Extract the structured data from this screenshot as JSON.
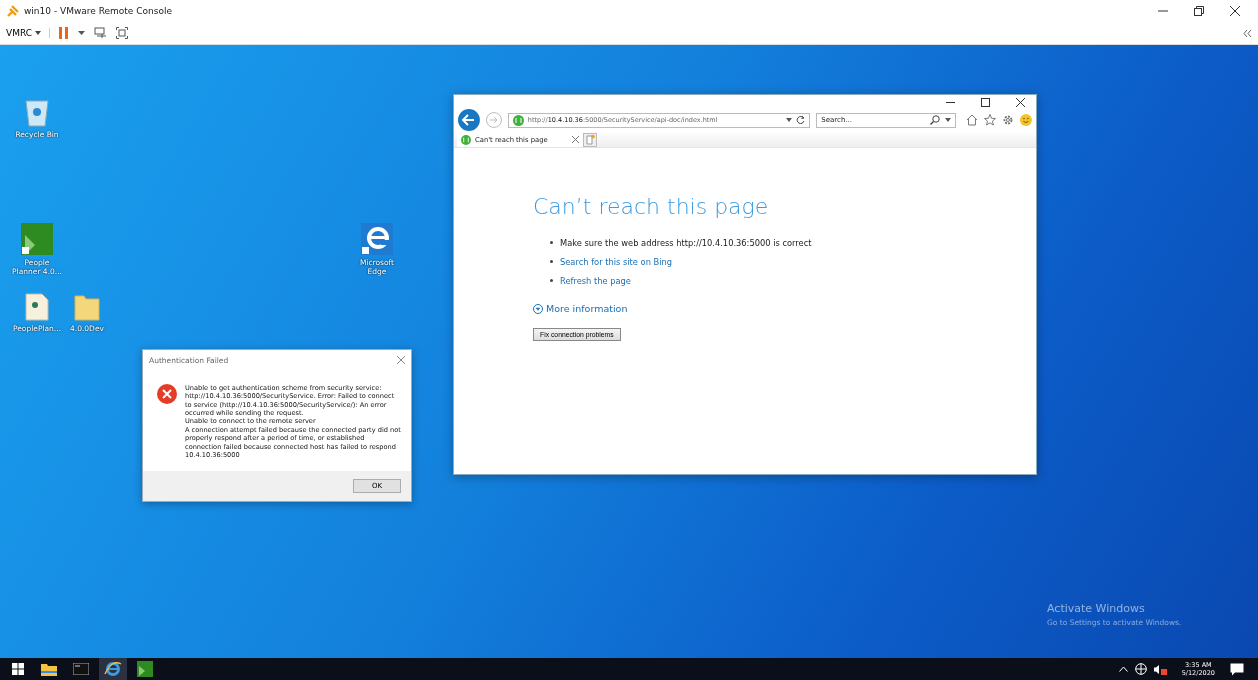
{
  "window": {
    "title": "win10 - VMware Remote Console"
  },
  "toolbar": {
    "menu": "VMRC"
  },
  "desktop_icons": [
    {
      "label": "Recycle Bin",
      "kind": "bin"
    },
    {
      "label": "People Planner 4.0...",
      "kind": "app"
    },
    {
      "label": "PeoplePlan...",
      "kind": "file"
    },
    {
      "label": "4.0.0Dev",
      "kind": "folder"
    },
    {
      "label": "Microsoft Edge",
      "kind": "edge"
    }
  ],
  "dialog": {
    "title": "Authentication Failed",
    "paragraphs": [
      "Unable to get authentication scheme from security service: http://10.4.10.36:5000/SecurityService. Error: Failed to connect to service (http://10.4.10.36:5000/SecurityService/): An error occurred while sending the request.",
      "Unable to connect to the remote server",
      "A connection attempt failed because the connected party did not properly respond after a period of time, or established connection failed because connected host has failed to respond 10.4.10.36:5000"
    ],
    "button": "OK"
  },
  "browser": {
    "address": "http://**10.4.10.36**:5000/SecurityService/api-doc/index.html",
    "search": {
      "placeholder": "Search..."
    },
    "tabs": [
      {
        "label": "Can't reach this page",
        "selected": true
      }
    ],
    "heading": "Can’t reach this page",
    "bullets": [
      {
        "text": "Make sure the web address http://10.4.10.36:5000 is correct",
        "kind": "text"
      },
      {
        "text": "Search for this site on Bing",
        "kind": "link"
      },
      {
        "text": "Refresh the page",
        "kind": "link"
      }
    ],
    "more": "More information",
    "button": "Fix connection problems"
  },
  "activation": {
    "title": "Activate Windows",
    "subtitle": "Go to Settings to activate Windows."
  },
  "taskbar": {
    "apps": [
      {
        "kind": "explorer",
        "selected": false
      },
      {
        "kind": "console",
        "selected": false
      },
      {
        "kind": "ie",
        "selected": true
      },
      {
        "kind": "dpp",
        "selected": false
      }
    ],
    "time": "3:35 AM",
    "date": "5/12/2020"
  }
}
